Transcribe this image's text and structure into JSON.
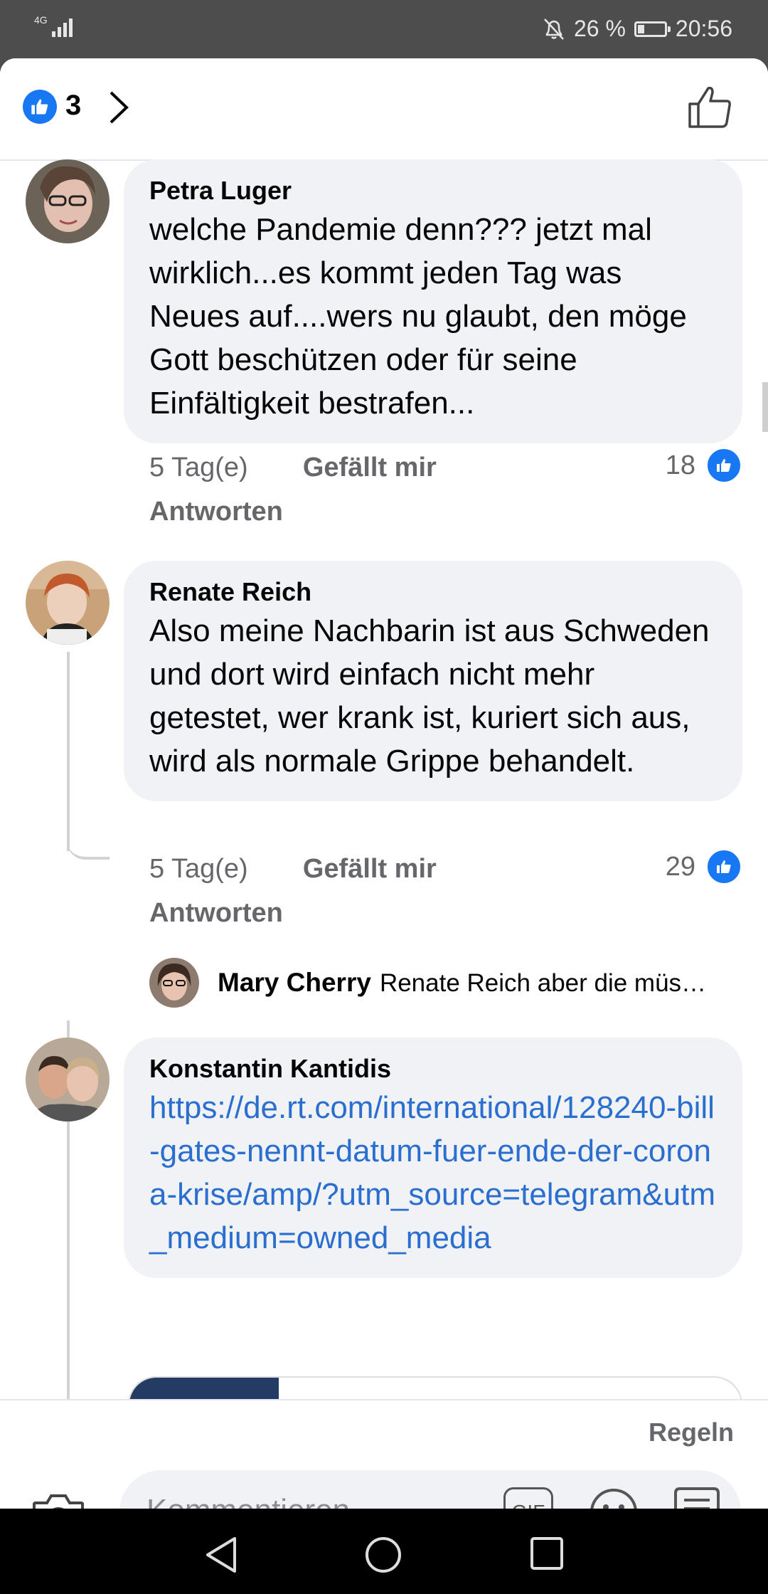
{
  "status_bar": {
    "network": "4G",
    "battery_percent": "26 %",
    "battery_level": 0.26,
    "time": "20:56"
  },
  "header": {
    "reaction_count": "3"
  },
  "comments": [
    {
      "author": "Petra Luger",
      "text": "welche Pandemie denn??? jetzt mal wirklich...es kommt jeden Tag was Neues auf....wers nu glaubt, den möge Gott beschützen oder für seine Einfältigkeit bestrafen...",
      "time": "5 Tag(e)",
      "like_label": "Gefällt mir",
      "reply_label": "Antworten",
      "like_count": "18"
    },
    {
      "author": "Renate Reich",
      "text": "Also meine Nachbarin ist aus Schweden und dort wird einfach nicht mehr getestet, wer krank ist, kuriert sich aus, wird als normale Grippe behandelt.",
      "time": "5 Tag(e)",
      "like_label": "Gefällt mir",
      "reply_label": "Antworten",
      "like_count": "29",
      "reply_preview": {
        "author": "Mary Cherry",
        "text": "Renate Reich aber die müs…"
      }
    },
    {
      "author": "Konstantin Kantidis",
      "link": "https://de.rt.com/international/128240-bill-gates-nennt-datum-fuer-ende-der-corona-krise/amp/?utm_source=telegram&utm_medium=owned_media"
    }
  ],
  "footer": {
    "rules_label": "Regeln",
    "input_placeholder": "Kommentieren ...",
    "gif_label": "GIF"
  },
  "colors": {
    "accent": "#1877f2",
    "link": "#2a6fcf",
    "bubble": "#f0f2f5"
  }
}
